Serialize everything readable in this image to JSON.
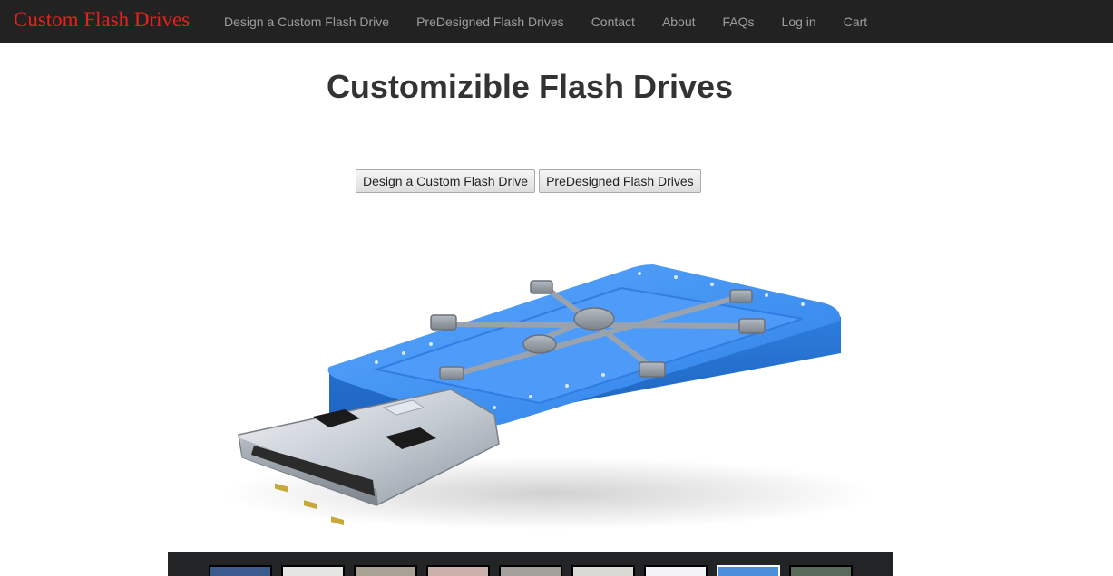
{
  "navbar": {
    "brand": "Custom Flash Drives",
    "links": [
      {
        "label": "Design a Custom Flash Drive"
      },
      {
        "label": "PreDesigned Flash Drives"
      },
      {
        "label": "Contact"
      },
      {
        "label": "About"
      },
      {
        "label": "FAQs"
      },
      {
        "label": "Log in"
      },
      {
        "label": "Cart"
      }
    ]
  },
  "main": {
    "title": "Customizible Flash Drives",
    "buttons": {
      "design": "Design a Custom Flash Drive",
      "predesigned": "PreDesigned Flash Drives"
    }
  },
  "hero_image": {
    "icon": "usb-flash-drive-vault-image"
  },
  "thumbnails": [
    {
      "color": "#3b5a8e"
    },
    {
      "color": "#e4e4e2"
    },
    {
      "color": "#a9a294"
    },
    {
      "color": "#c9b0aa"
    },
    {
      "color": "#a4a19c"
    },
    {
      "color": "#d9d9d4"
    },
    {
      "color": "#f4f4f6"
    },
    {
      "color": "#4a8fd9"
    },
    {
      "color": "#5a6a5a"
    }
  ],
  "colors": {
    "navbar_bg": "#222222",
    "brand": "#e8221b",
    "nav_link": "#9d9d9d",
    "drive_blue": "#3d8ff0"
  }
}
